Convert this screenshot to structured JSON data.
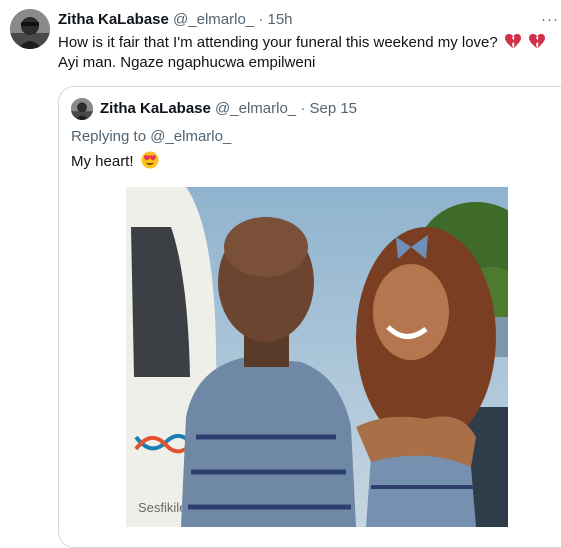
{
  "tweet": {
    "author_name": "Zitha KaLabase",
    "author_handle": "@_elmarlo_",
    "separator": "·",
    "time": "15h",
    "more_label": "···",
    "text_line1": "How is it fair that I'm attending your funeral this weekend my love?",
    "text_line2": "Ayi man. Ngaze ngaphucwa empilweni",
    "line1_emoji": "broken-heart-icon"
  },
  "quoted_tweet": {
    "author_name": "Zitha KaLabase",
    "author_handle": "@_elmarlo_",
    "separator": "·",
    "date": "Sep 15",
    "replying_prefix": "Replying to",
    "replying_handle": "@_elmarlo_",
    "text": "My heart!",
    "emoji": "heart-eyes-emoji",
    "photo_text": "Sesfikile"
  },
  "colors": {
    "text": "#0f1419",
    "secondary": "#536471",
    "border": "#cfd9de",
    "broken_heart": "#d1314b"
  }
}
